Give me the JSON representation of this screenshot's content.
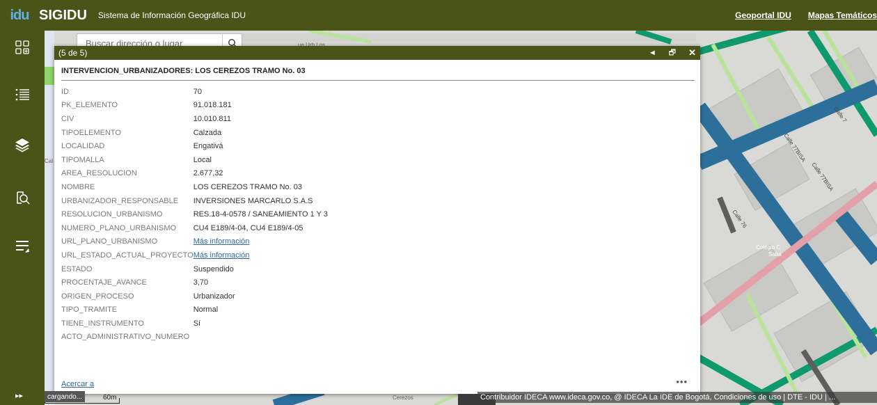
{
  "header": {
    "logo": "idu",
    "title": "SIGIDU",
    "subtitle": "Sistema de Información Geográfica IDU",
    "links": [
      "Geoportal IDU",
      "Mapas Temáticos"
    ]
  },
  "search": {
    "placeholder": "Buscar dirección o lugar"
  },
  "map_labels": {
    "street1": "ue Urb Los",
    "street2": "Calle 77BISA",
    "street3": "Calle 77BISA",
    "street4": "Calle 76",
    "street5": "Calle 7",
    "street6": "Cerezos",
    "street7": "Cal",
    "place1": "Colegio C",
    "place2": "Saba"
  },
  "popup": {
    "counter": "(5 de 5)",
    "prev_label": "◄",
    "dock_label": "🗗",
    "close_label": "✕",
    "title": "INTERVENCION_URBANIZADORES: LOS CEREZOS TRAMO No. 03",
    "attributes": [
      {
        "key": "ID",
        "value": "70"
      },
      {
        "key": "PK_ELEMENTO",
        "value": "91.018.181"
      },
      {
        "key": "CIV",
        "value": "10.010.811"
      },
      {
        "key": "TIPOELEMENTO",
        "value": "Calzada"
      },
      {
        "key": "LOCALIDAD",
        "value": "Engativá"
      },
      {
        "key": "TIPOMALLA",
        "value": "Local"
      },
      {
        "key": "AREA_RESOLUCION",
        "value": "2.677,32"
      },
      {
        "key": "NOMBRE",
        "value": "LOS CEREZOS TRAMO No. 03"
      },
      {
        "key": "URBANIZADOR_RESPONSABLE",
        "value": "INVERSIONES MARCARLO S.A.S"
      },
      {
        "key": "RESOLUCION_URBANISMO",
        "value": "RES.18-4-0578 / SANEAMIENTO 1 Y 3"
      },
      {
        "key": "NUMERO_PLANO_URBANISMO",
        "value": "CU4 E189/4-04, CU4 E189/4-05"
      },
      {
        "key": "URL_PLANO_URBANISMO",
        "value": "Más información",
        "link": true
      },
      {
        "key": "URL_ESTADO_ACTUAL_PROYECTO",
        "value": "Más información",
        "link": true
      },
      {
        "key": "ESTADO",
        "value": "Suspendido"
      },
      {
        "key": "PROCENTAJE_AVANCE",
        "value": "3,70"
      },
      {
        "key": "ORIGEN_PROCESO",
        "value": "Urbanizador"
      },
      {
        "key": "TIPO_TRAMITE",
        "value": "Normal"
      },
      {
        "key": "TIENE_INSTRUMENTO",
        "value": "Sí"
      },
      {
        "key": "ACTO_ADMINISTRATIVO_NUMERO",
        "value": ""
      }
    ],
    "zoom_link": "Acercar a",
    "more_label": "•••"
  },
  "scale": {
    "label": "60m"
  },
  "loading": "cargando...",
  "expand_label": "▸▸",
  "attribution": "Contribuidor IDECA www.ideca.gov.co, @ IDECA La IDE de Bogotá, Condiciones de uso | DTE - IDU | ...",
  "colors": {
    "brand": "#4a5318",
    "road_blue": "#2c6f9a",
    "road_green": "#0f9a6d",
    "light_green": "#b9e39a",
    "pink": "#e3a0a8",
    "link": "#2f67a8"
  }
}
